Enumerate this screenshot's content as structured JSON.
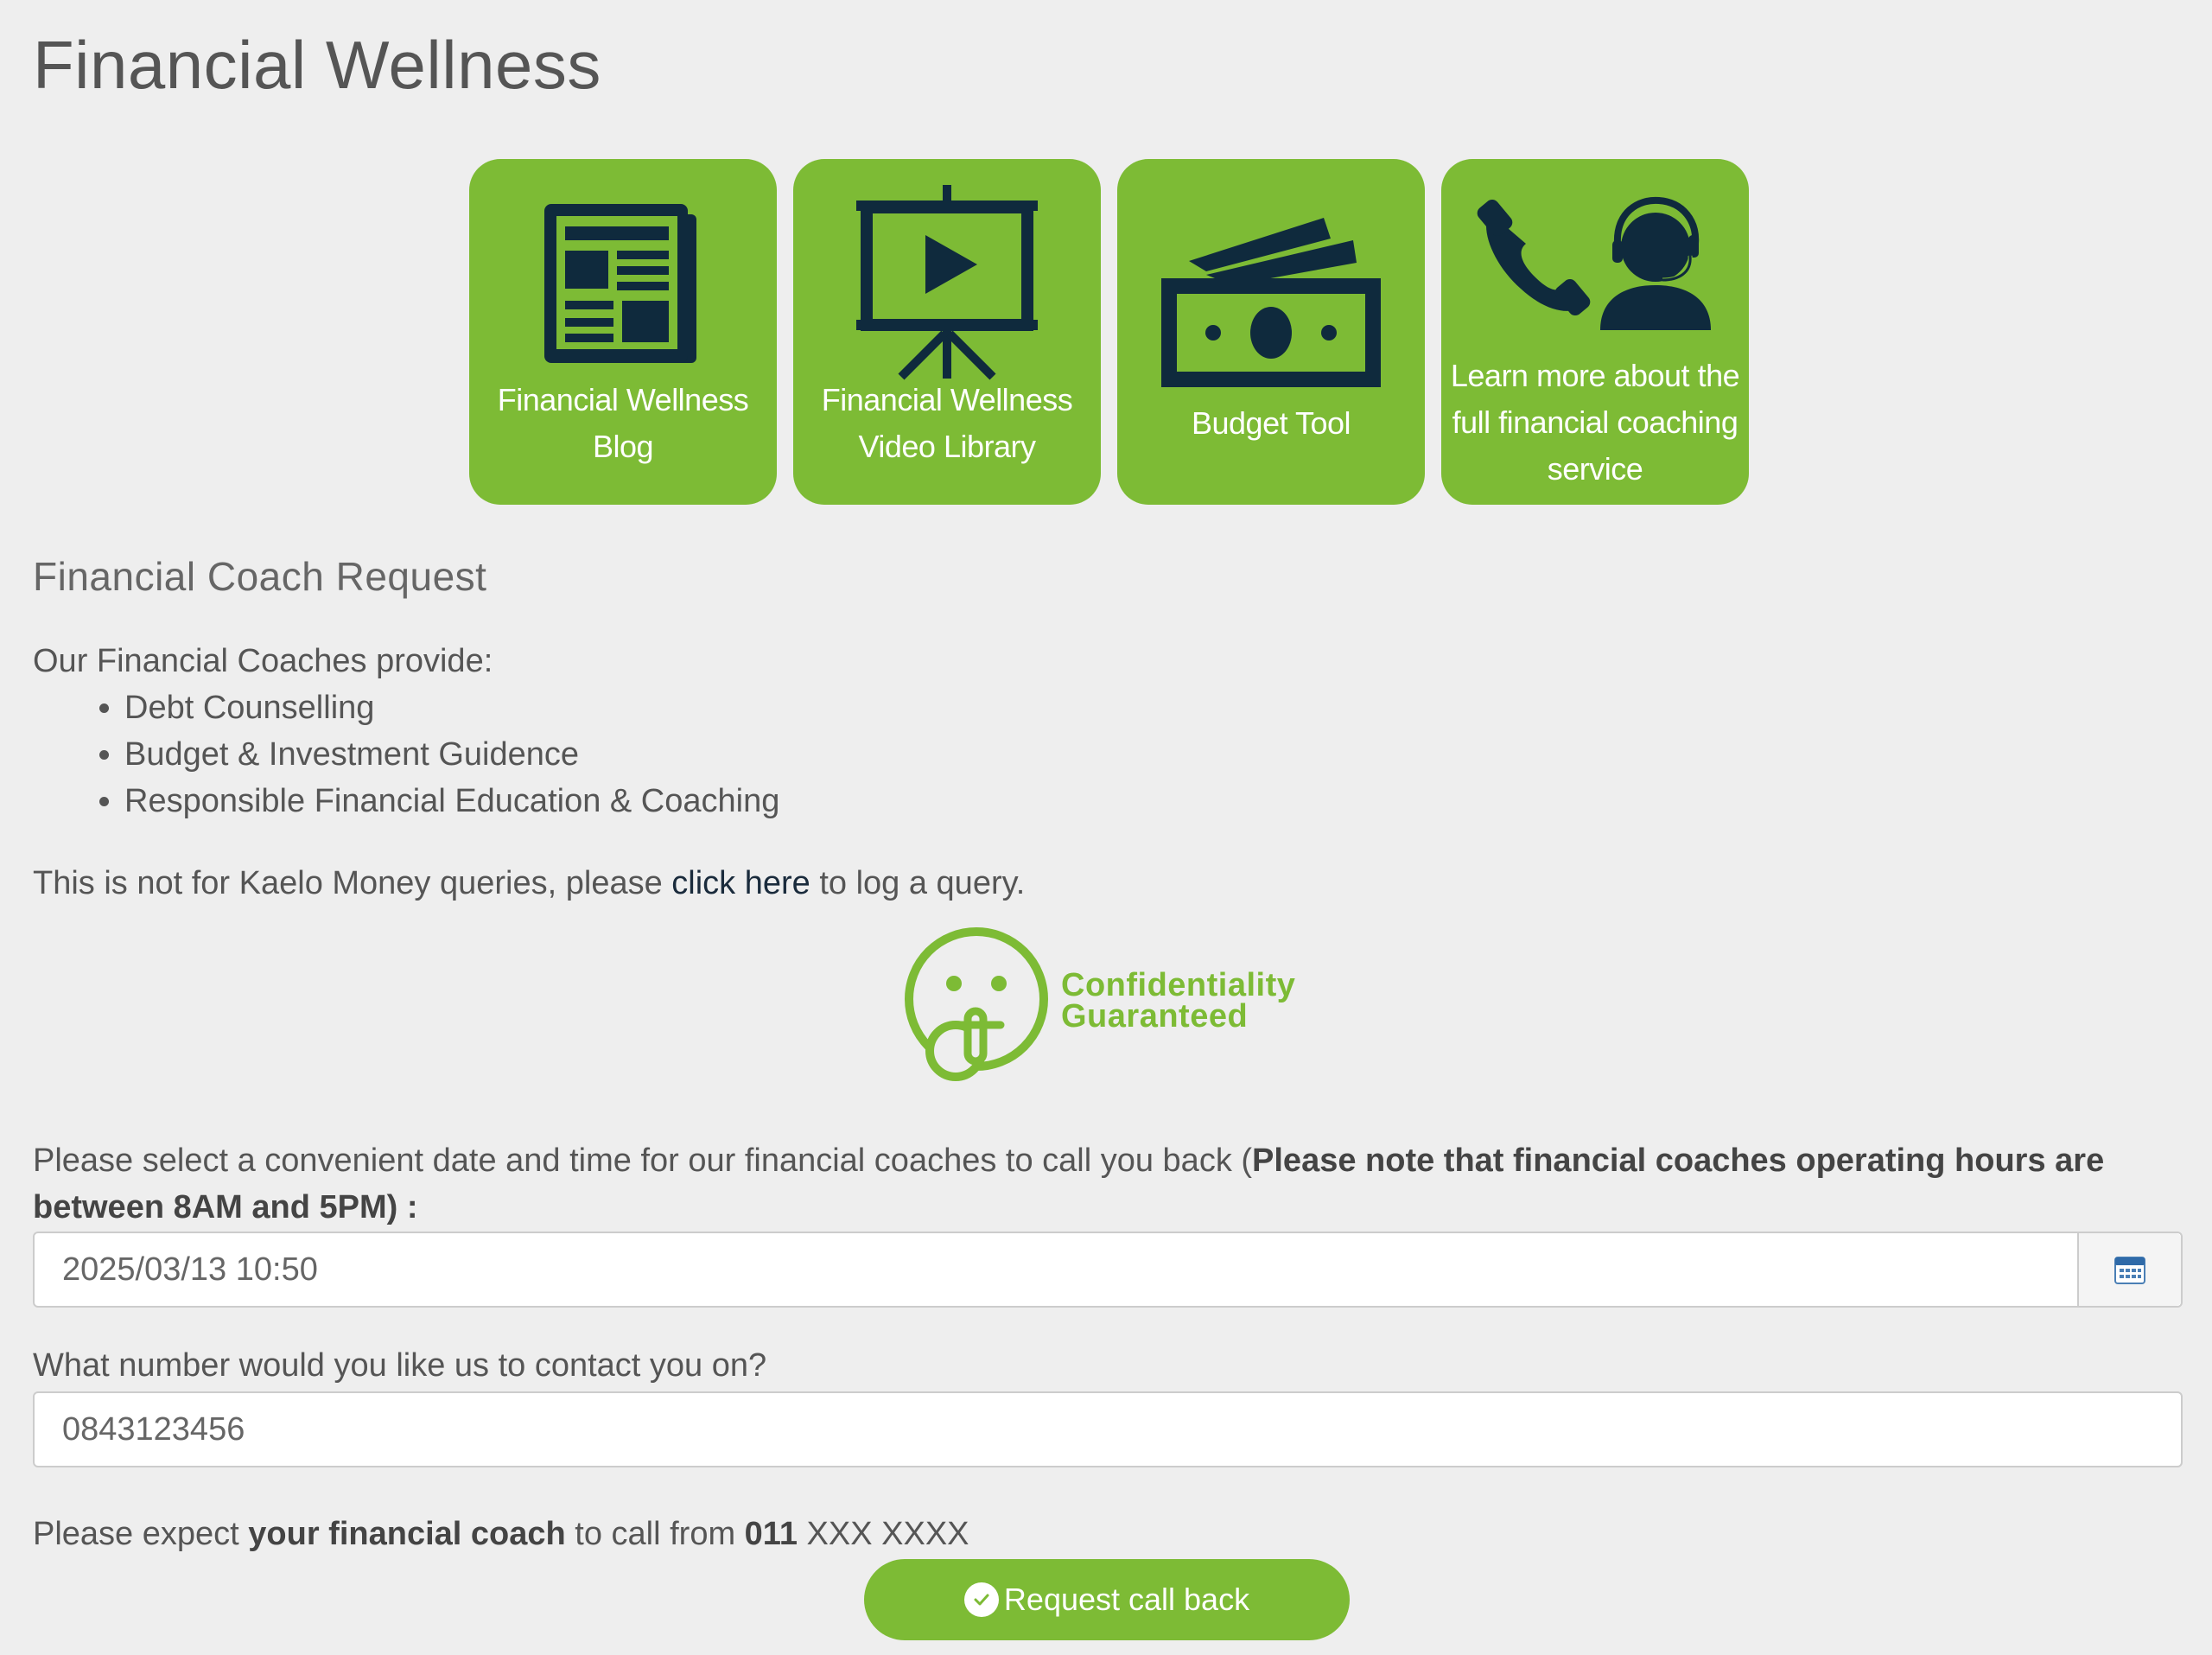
{
  "page": {
    "title": "Financial Wellness"
  },
  "tiles": [
    {
      "label_line1": "Financial Wellness",
      "label_line2": "Blog",
      "icon": "newspaper-icon"
    },
    {
      "label_line1": "Financial Wellness",
      "label_line2": "Video Library",
      "icon": "video-presentation-icon"
    },
    {
      "label_line1": "Budget Tool",
      "icon": "cash-icon"
    },
    {
      "label_line1": "Learn more about the",
      "label_line2": "full financial coaching",
      "label_line3": "service",
      "icon": "phone-agent-icon"
    }
  ],
  "coach_request": {
    "heading": "Financial Coach Request",
    "intro": "Our Financial Coaches provide:",
    "services": [
      "Debt Counselling",
      "Budget & Investment Guidence",
      "Responsible Financial Education & Coaching"
    ],
    "note_before": "This is not for Kaelo Money queries, please ",
    "note_link": "click here",
    "note_after": " to log a query."
  },
  "badge": {
    "line1": "Confidentiality",
    "line2": "Guaranteed",
    "icon": "shush-face-icon"
  },
  "form": {
    "datetime_label": "Please select a convenient date and time for our financial coaches to call you back (",
    "datetime_label_bold": "Please note that financial coaches operating hours are between 8AM and 5PM)",
    "datetime_label_end": " :",
    "datetime_value": "2025/03/13 10:50",
    "calendar_icon": "calendar-icon",
    "phone_label": "What number would you like us to contact you on?",
    "phone_value": "0843123456",
    "expect_before": "Please expect ",
    "expect_bold": "your financial coach",
    "expect_mid": " to call from ",
    "expect_number_bold": "011",
    "expect_number_rest": " XXX XXXX",
    "submit_label": "Request call back",
    "submit_icon": "check-circle-icon"
  },
  "colors": {
    "brand_green": "#7dbb35",
    "icon_navy": "#0f2a3d",
    "background": "#eeeeee"
  }
}
